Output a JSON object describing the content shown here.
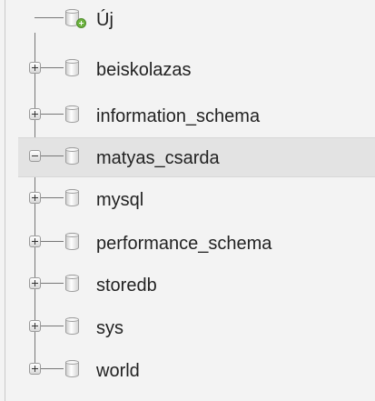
{
  "navigation": {
    "new_database": {
      "label": "Új"
    },
    "databases": [
      {
        "name": "beiskolazas",
        "state": "collapsed"
      },
      {
        "name": "information_schema",
        "state": "collapsed"
      },
      {
        "name": "matyas_csarda",
        "state": "expanded",
        "selected": true
      },
      {
        "name": "mysql",
        "state": "collapsed"
      },
      {
        "name": "performance_schema",
        "state": "collapsed"
      },
      {
        "name": "storedb",
        "state": "collapsed"
      },
      {
        "name": "sys",
        "state": "collapsed"
      },
      {
        "name": "world",
        "state": "collapsed"
      }
    ]
  },
  "colors": {
    "panel_background": "#f3f3f3",
    "selected_row_background": "#e3e3e3",
    "tree_line": "#777777",
    "new_badge": "#6db33f"
  }
}
